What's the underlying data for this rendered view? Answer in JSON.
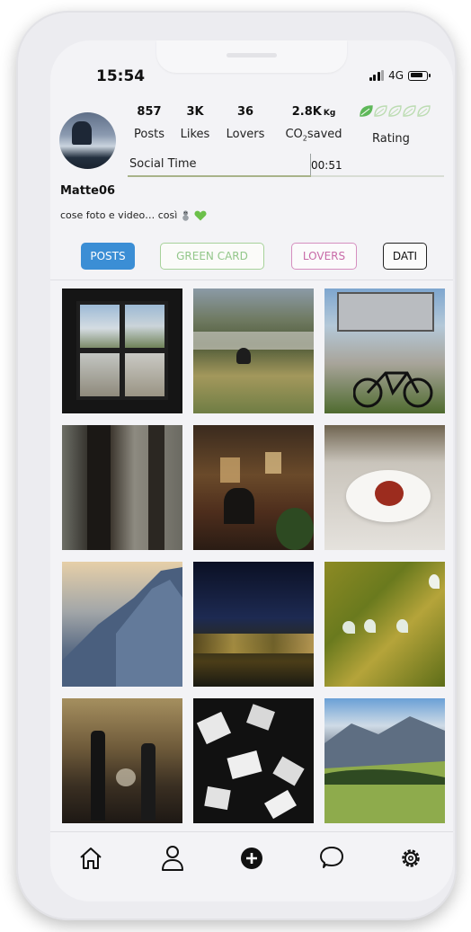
{
  "status": {
    "time": "15:54",
    "network": "4G"
  },
  "profile": {
    "username": "Matte06",
    "bio": "cose foto e video… così",
    "stats": [
      {
        "value": "857",
        "label": "Posts"
      },
      {
        "value": "3K",
        "label": "Likes"
      },
      {
        "value": "36",
        "label": "Lovers"
      },
      {
        "value": "2.8K",
        "unit": "Kg",
        "label_main": "CO",
        "label_sub": "2",
        "label_rest": "saved"
      }
    ],
    "rating": {
      "label": "Rating",
      "leaves_total": 5,
      "leaves_filled": 1
    },
    "social_time": {
      "label": "Social Time",
      "value": "00:51",
      "fraction": 0.58
    }
  },
  "tabs": [
    {
      "label": "POSTS",
      "active": true
    },
    {
      "label": "GREEN CARD",
      "active": false
    },
    {
      "label": "LOVERS",
      "active": false
    },
    {
      "label": "DATI",
      "active": false
    }
  ],
  "nav": [
    "home-icon",
    "profile-icon",
    "add-post-icon",
    "chat-icon",
    "settings-icon"
  ],
  "colors": {
    "accent_blue": "#3b8ed5",
    "green": "#8cc47e",
    "pink": "#c86aa8",
    "leaf_filled": "#5fb85a",
    "leaf_empty": "#bcdcb2"
  }
}
